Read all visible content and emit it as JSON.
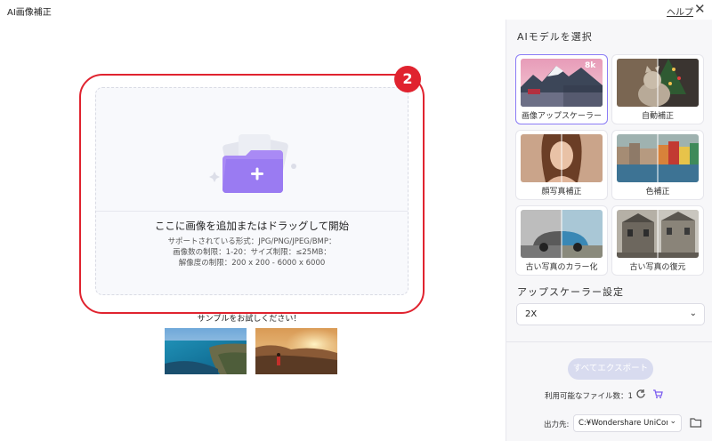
{
  "window": {
    "title": "AI画像補正",
    "help": "ヘルプ"
  },
  "upload": {
    "title": "ここに画像を追加またはドラッグして開始",
    "formats": "サポートされている形式：JPG/PNG/JPEG/BMP：",
    "limits": "画像数の制限：1-20：サイズ制限：≤25MB：",
    "resolution": "解像度の制限：200 x 200 - 6000 x 6000",
    "step_badge": "2"
  },
  "samples": {
    "label": "サンプルをお試しください！"
  },
  "sidebar": {
    "model_title": "AIモデルを選択",
    "models": [
      {
        "label": "画像アップスケーラー",
        "badge": "8k",
        "selected": true
      },
      {
        "label": "自動補正"
      },
      {
        "label": "顔写真補正"
      },
      {
        "label": "色補正"
      },
      {
        "label": "古い写真のカラー化"
      },
      {
        "label": "古い写真の復元"
      }
    ],
    "upscale_title": "アップスケーラー設定",
    "upscale_value": "2X",
    "export_button": "すべてエクスポート",
    "file_count": "利用可能なファイル数：1",
    "output_label": "出力先:",
    "output_value": "C:¥Wondershare UniConv"
  },
  "colors": {
    "accent": "#8b7cf6",
    "highlight": "#e0232f",
    "export_disabled": "#d8dbef"
  }
}
